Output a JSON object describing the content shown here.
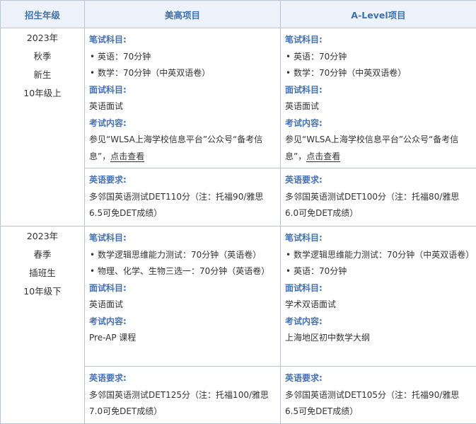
{
  "header": {
    "grade": "招生年级",
    "meigao": "美高项目",
    "alevel": "A-Level项目"
  },
  "rows": [
    {
      "grade_lines": [
        "2023年",
        "秋季",
        "新生",
        "10年级上"
      ],
      "meigao": {
        "written_label": "笔试科目:",
        "written_items": [
          "英语：70分钟",
          "数学：70分钟（中英双语卷）"
        ],
        "interview_label": "面试科目:",
        "interview_text": "英语面试",
        "content_label": "考试内容:",
        "content_text": "参见“WLSA上海学校信息平台”公众号“备考信息”，",
        "content_link": "点击查看",
        "english_label": "英语要求:",
        "english_text": "多邻国英语测试DET110分（注：托福90/雅思6.5可免DET成绩）"
      },
      "alevel": {
        "written_label": "笔试科目:",
        "written_items": [
          "英语：70分钟",
          "数学：70分钟（中英双语卷）"
        ],
        "interview_label": "面试科目:",
        "interview_text": "英语面试",
        "content_label": "考试内容:",
        "content_text": "参见“WLSA上海学校信息平台”公众号“备考信息”，",
        "content_link": "点击查看",
        "english_label": "英语要求:",
        "english_text": "多邻国英语测试DET100分（注：托福80/雅思6.0可免DET成绩）"
      }
    },
    {
      "grade_lines": [
        "2023年",
        "春季",
        "插班生",
        "10年级下"
      ],
      "meigao": {
        "written_label": "笔试科目:",
        "written_items": [
          "数学逻辑思维能力测试：70分钟（英语卷）",
          "物理、化学、生物三选一：70分钟（英语卷）"
        ],
        "interview_label": "面试科目:",
        "interview_text": "英语面试",
        "content_label": "考试内容:",
        "content_text": "Pre-AP 课程",
        "english_label": "英语要求:",
        "english_text": "多邻国英语测试DET125分（注：托福100/雅思7.0可免DET成绩）"
      },
      "alevel": {
        "written_label": "笔试科目:",
        "written_items": [
          "数学逻辑思维能力测试：70分钟（中英双语卷）",
          "英语：70分钟"
        ],
        "interview_label": "面试科目:",
        "interview_text": "学术双语面试",
        "content_label": "考试内容:",
        "content_text": "上海地区初中数学大纲",
        "english_label": "英语要求:",
        "english_text": "多邻国英语测试DET105分（注：托福90/雅思6.5可免DET成绩）"
      }
    }
  ]
}
